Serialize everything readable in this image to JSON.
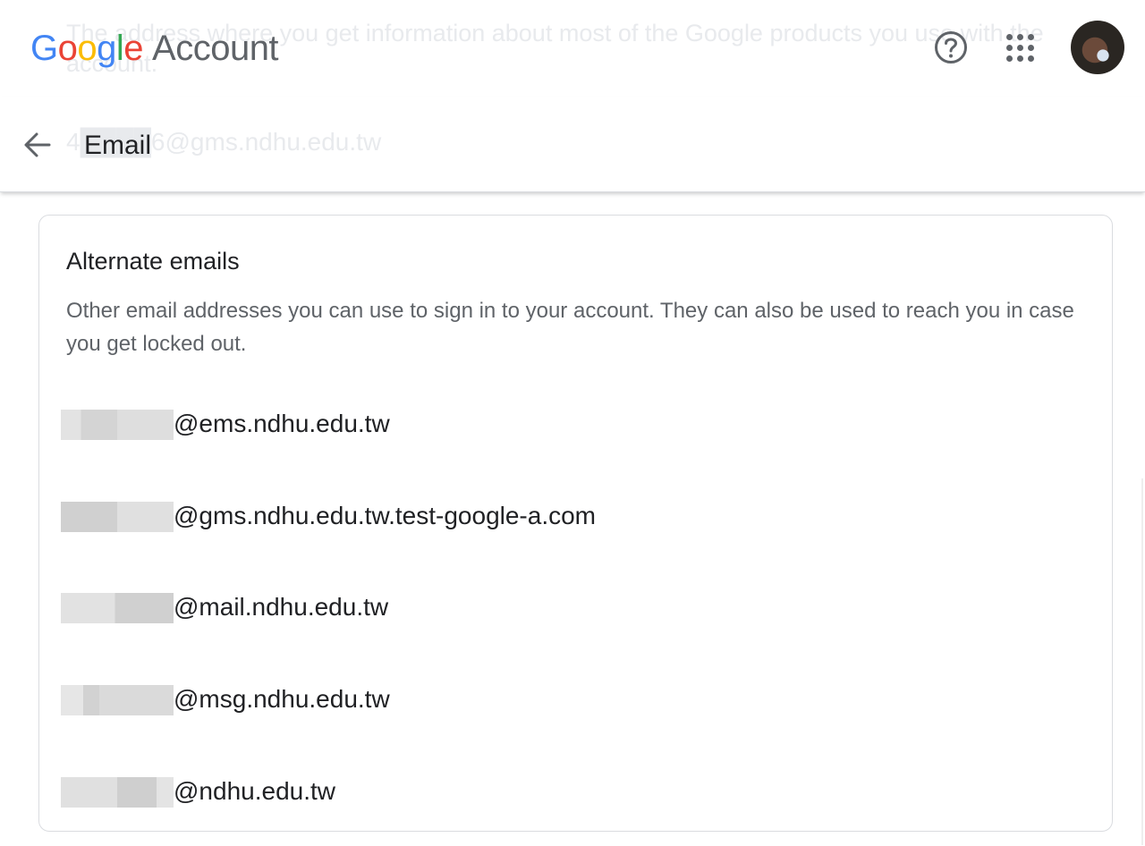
{
  "header": {
    "logo_letters": [
      "G",
      "o",
      "o",
      "g",
      "l",
      "e"
    ],
    "product_name": "Account"
  },
  "background_text": {
    "description_line1": "The address where you get information about most of the Google products you use with the",
    "description_line2": "account.",
    "primary_email": "4████6@gms.ndhu.edu.tw"
  },
  "page": {
    "title": "Email"
  },
  "card": {
    "title": "Alternate emails",
    "description": "Other email addresses you can use to sign in to your account. They can also be used to reach you in case you get locked out.",
    "emails": [
      {
        "domain_part": "@ems.ndhu.edu.tw"
      },
      {
        "domain_part": "@gms.ndhu.edu.tw.test-google-a.com"
      },
      {
        "domain_part": "@mail.ndhu.edu.tw"
      },
      {
        "domain_part": "@msg.ndhu.edu.tw"
      },
      {
        "domain_part": "@ndhu.edu.tw"
      }
    ]
  },
  "icons": {
    "back": "arrow-back-icon",
    "help": "help-circle-icon",
    "apps": "apps-grid-icon",
    "avatar": "account-avatar"
  },
  "colors": {
    "google_blue": "#4285F4",
    "google_red": "#EA4335",
    "google_yellow": "#FBBC05",
    "google_green": "#34A853",
    "text_primary": "#202124",
    "text_secondary": "#5f6368",
    "border": "#dadce0"
  }
}
